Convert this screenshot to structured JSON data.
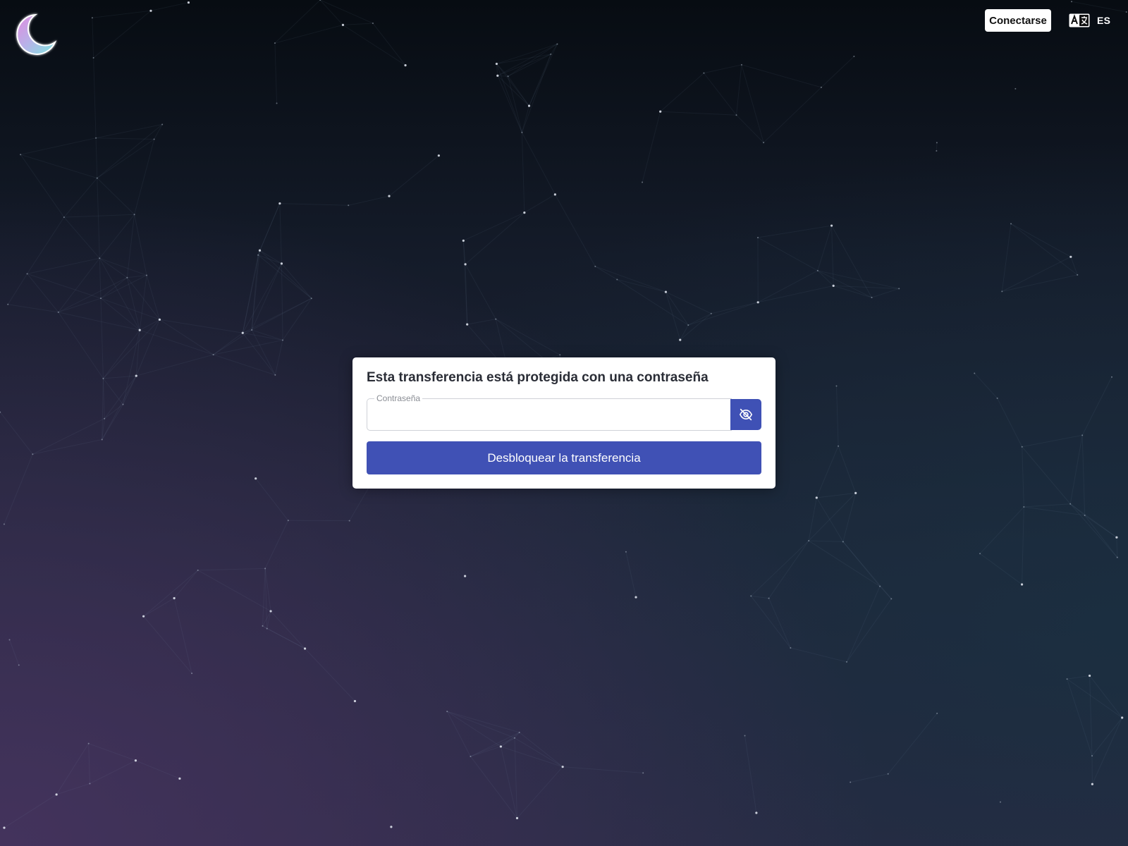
{
  "header": {
    "logo_icon": "crescent-moon-icon",
    "connect_label": "Conectarse",
    "language_icon": "translate-icon",
    "language_code": "ES"
  },
  "unlock_card": {
    "title": "Esta transferencia está protegida con una contraseña",
    "password_label": "Contraseña",
    "password_value": "",
    "toggle_icon": "eye-off-icon",
    "unlock_label": "Desbloquear la transferencia"
  },
  "colors": {
    "accent": "#3f51b5",
    "background_top": "#070c12",
    "background_bottom": "#2b2a44"
  }
}
